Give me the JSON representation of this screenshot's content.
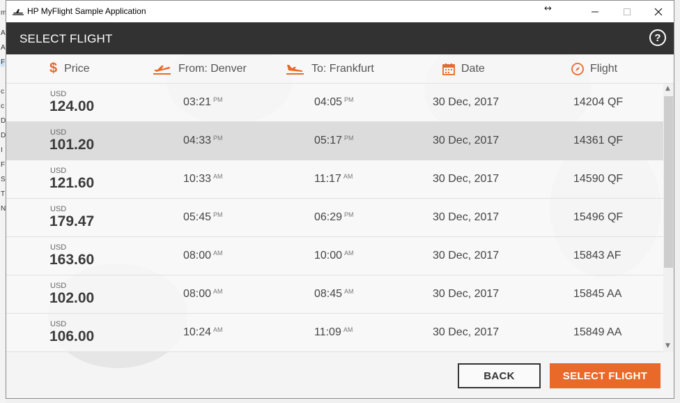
{
  "background_window": {
    "letters": [
      "m",
      "A",
      "A",
      "F",
      "",
      "c",
      "c",
      "D",
      "D",
      "I",
      "F",
      "S",
      "T",
      "N"
    ]
  },
  "window": {
    "title": "HP MyFlight Sample Application"
  },
  "header": {
    "title": "SELECT FLIGHT",
    "help_label": "?"
  },
  "columns": {
    "price": "Price",
    "from": "From: Denver",
    "to": "To: Frankfurt",
    "date": "Date",
    "flight": "Flight"
  },
  "flights": [
    {
      "currency": "USD",
      "price": "124.00",
      "depart": "03:21",
      "depart_ampm": "PM",
      "arrive": "04:05",
      "arrive_ampm": "PM",
      "date": "30 Dec, 2017",
      "flight": "14204 QF"
    },
    {
      "currency": "USD",
      "price": "101.20",
      "depart": "04:33",
      "depart_ampm": "PM",
      "arrive": "05:17",
      "arrive_ampm": "PM",
      "date": "30 Dec, 2017",
      "flight": "14361 QF"
    },
    {
      "currency": "USD",
      "price": "121.60",
      "depart": "10:33",
      "depart_ampm": "AM",
      "arrive": "11:17",
      "arrive_ampm": "AM",
      "date": "30 Dec, 2017",
      "flight": "14590 QF"
    },
    {
      "currency": "USD",
      "price": "179.47",
      "depart": "05:45",
      "depart_ampm": "PM",
      "arrive": "06:29",
      "arrive_ampm": "PM",
      "date": "30 Dec, 2017",
      "flight": "15496 QF"
    },
    {
      "currency": "USD",
      "price": "163.60",
      "depart": "08:00",
      "depart_ampm": "AM",
      "arrive": "10:00",
      "arrive_ampm": "AM",
      "date": "30 Dec, 2017",
      "flight": "15843 AF"
    },
    {
      "currency": "USD",
      "price": "102.00",
      "depart": "08:00",
      "depart_ampm": "AM",
      "arrive": "08:45",
      "arrive_ampm": "AM",
      "date": "30 Dec, 2017",
      "flight": "15845 AA"
    },
    {
      "currency": "USD",
      "price": "106.00",
      "depart": "10:24",
      "depart_ampm": "AM",
      "arrive": "11:09",
      "arrive_ampm": "AM",
      "date": "30 Dec, 2017",
      "flight": "15849 AA"
    }
  ],
  "selected_row": 1,
  "buttons": {
    "back": "BACK",
    "select": "SELECT FLIGHT"
  },
  "colors": {
    "accent": "#e8692a",
    "header_bg": "#323232"
  },
  "icons": {
    "price": "dollar-icon",
    "from": "plane-departure-icon",
    "to": "plane-arrival-icon",
    "date": "calendar-icon",
    "flight": "compass-icon"
  }
}
